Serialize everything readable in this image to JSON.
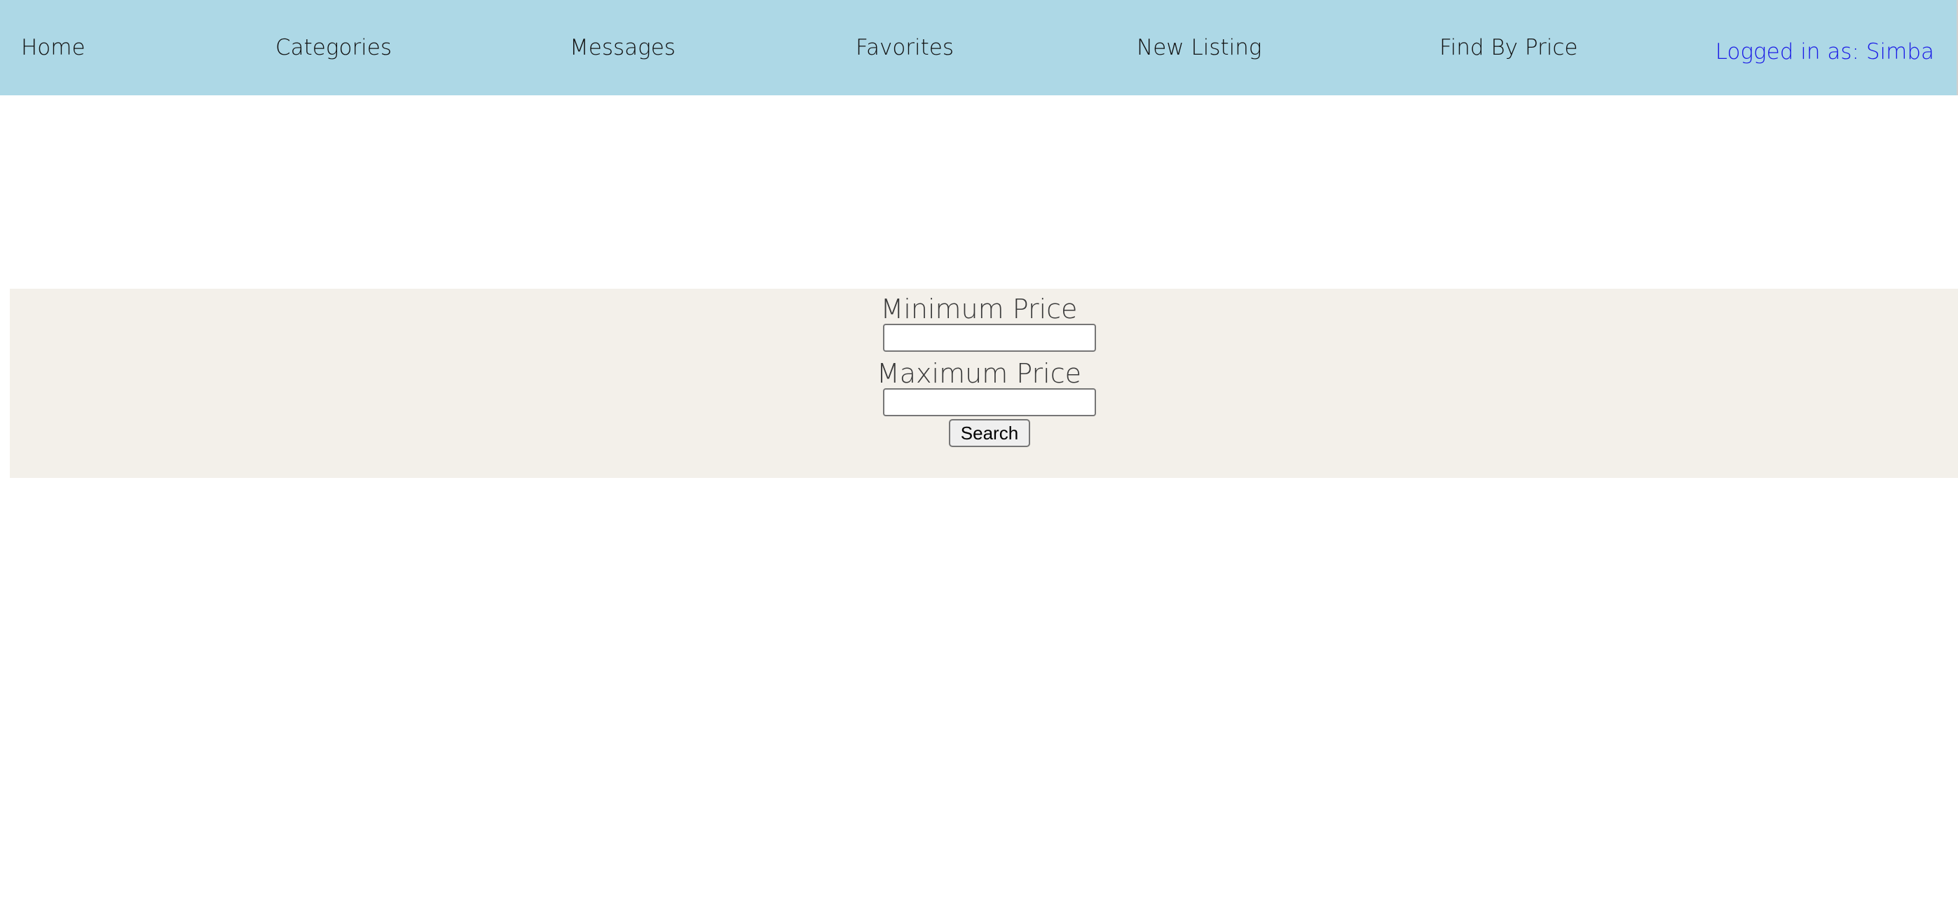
{
  "nav": {
    "home": "Home",
    "categories": "Categories",
    "messages": "Messages",
    "favorites": "Favorites",
    "new_listing": "New Listing",
    "find_by_price": "Find By Price",
    "logged_in": "Logged in as: Simba"
  },
  "search_form": {
    "min_label": "Minimum Price",
    "min_value": "",
    "max_label": "Maximum Price",
    "max_value": "",
    "submit_label": "Search"
  },
  "colors": {
    "navbar_background": "#add8e6",
    "user_link": "#1a1ae6",
    "panel_background": "#f3f0ea"
  }
}
